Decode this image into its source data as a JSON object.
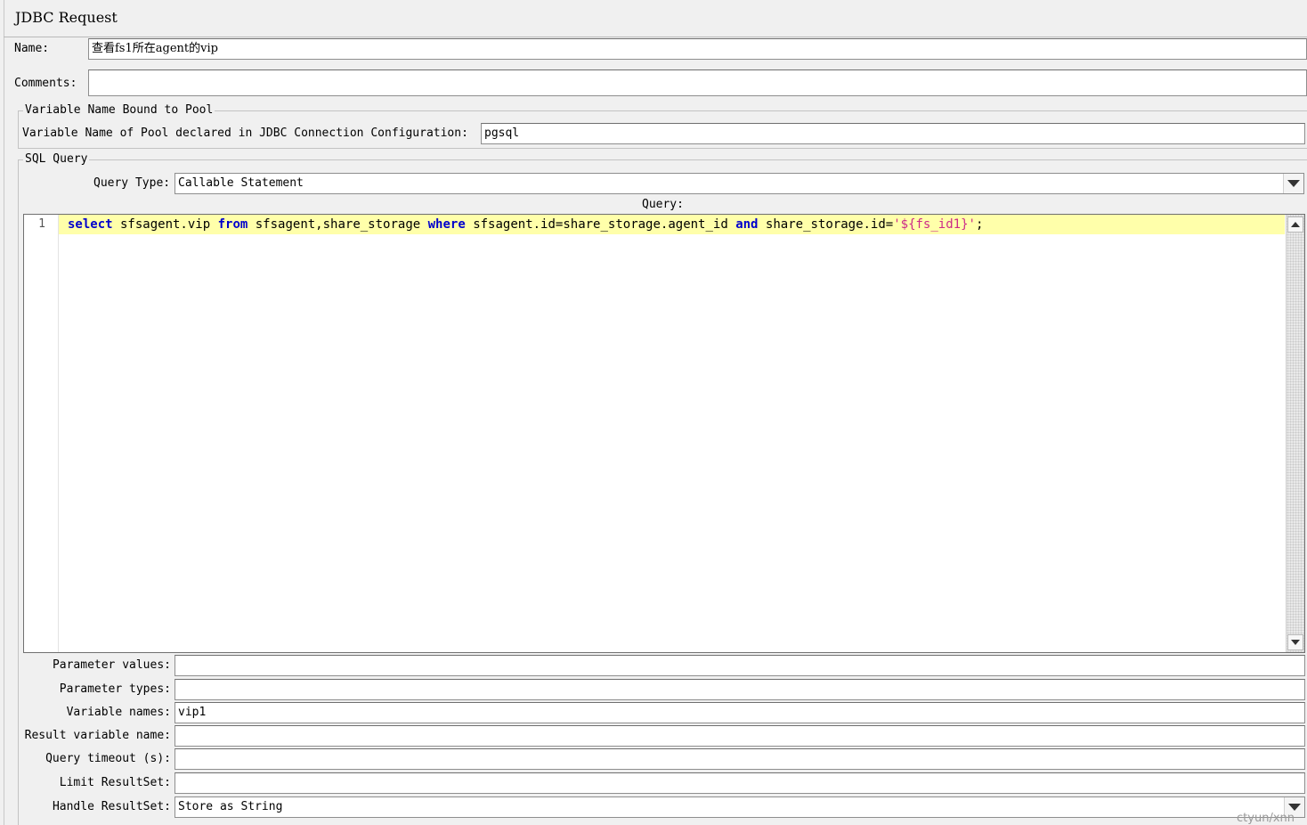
{
  "panel": {
    "title": "JDBC Request"
  },
  "name": {
    "label": "Name:",
    "value": "查看fs1所在agent的vip"
  },
  "comments": {
    "label": "Comments:",
    "value": ""
  },
  "pool_group": {
    "legend": "Variable Name Bound to Pool",
    "pool_label": "Variable Name of Pool declared in JDBC Connection Configuration:",
    "pool_value": "pgsql"
  },
  "sql_group": {
    "legend": "SQL Query",
    "query_type_label": "Query Type:",
    "query_type_value": "Callable Statement",
    "query_label": "Query:",
    "line_number": "1",
    "code": {
      "t1": "select",
      "t2": " sfsagent.vip ",
      "t3": "from",
      "t4": " sfsagent,share_storage ",
      "t5": "where",
      "t6": " sfsagent.id=share_storage.agent_id ",
      "t7": "and",
      "t8": " share_storage.id=",
      "t9": "'${fs_id1}'",
      "t10": ";"
    }
  },
  "params": {
    "parameter_values": {
      "label": "Parameter values:",
      "value": ""
    },
    "parameter_types": {
      "label": "Parameter types:",
      "value": ""
    },
    "variable_names": {
      "label": "Variable names:",
      "value": "vip1"
    },
    "result_variable_name": {
      "label": "Result variable name:",
      "value": ""
    },
    "query_timeout": {
      "label": "Query timeout (s):",
      "value": ""
    },
    "limit_resultset": {
      "label": "Limit ResultSet:",
      "value": ""
    },
    "handle_resultset": {
      "label": "Handle ResultSet:",
      "value": "Store as String"
    }
  },
  "watermark": "ctyun/xnn",
  "colors": {
    "current_line": "#ffffaa",
    "keyword": "#0000cc",
    "string": "#cc2a88",
    "panel_bg": "#f0f0f0"
  }
}
